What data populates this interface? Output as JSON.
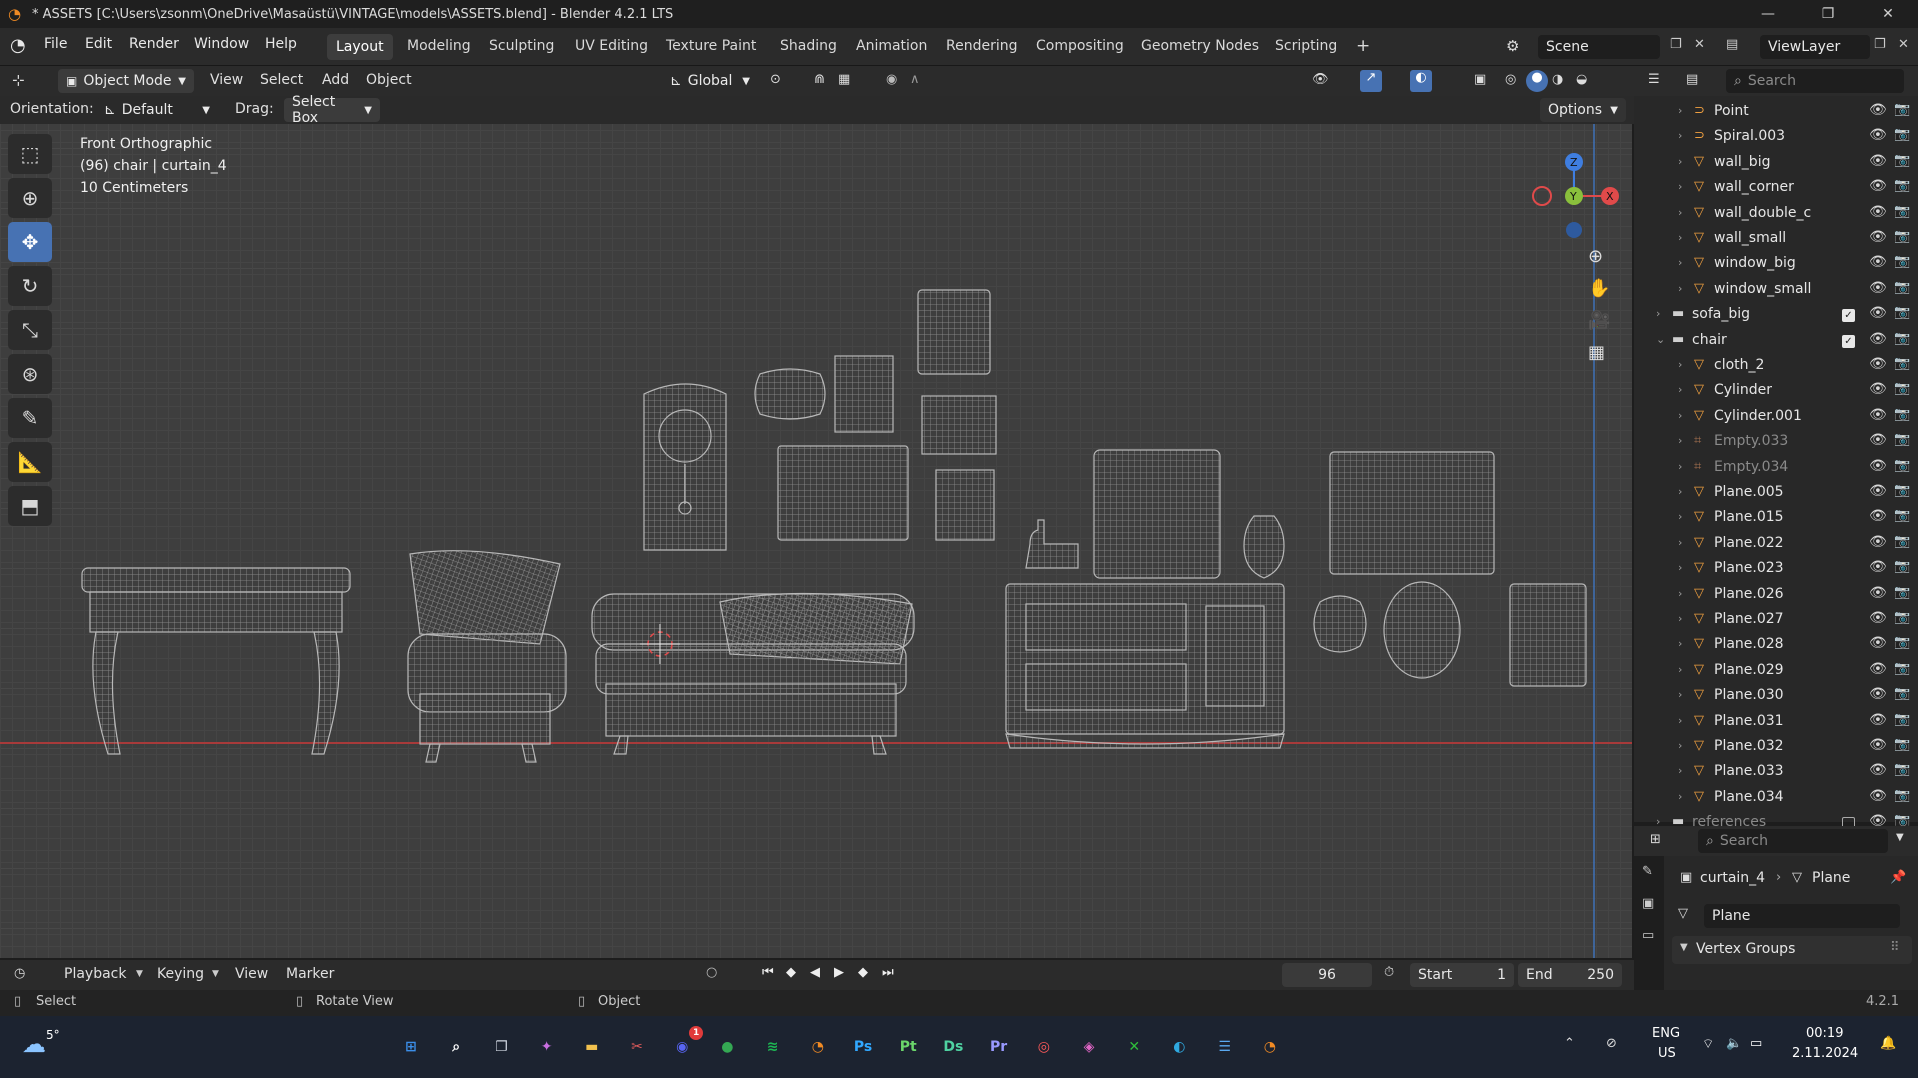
{
  "window": {
    "title": "* ASSETS [C:\\Users\\zsonm\\OneDrive\\Masaüstü\\VINTAGE\\models\\ASSETS.blend] - Blender 4.2.1 LTS",
    "controls": [
      "—",
      "❐",
      "✕"
    ]
  },
  "menu": [
    "File",
    "Edit",
    "Render",
    "Window",
    "Help"
  ],
  "workspaces": [
    "Layout",
    "Modeling",
    "Sculpting",
    "UV Editing",
    "Texture Paint",
    "Shading",
    "Animation",
    "Rendering",
    "Compositing",
    "Geometry Nodes",
    "Scripting"
  ],
  "add_tab": "+",
  "scene": {
    "label": "Scene",
    "view_layer": "ViewLayer"
  },
  "header": {
    "mode": "Object Mode",
    "view": "View",
    "select": "Select",
    "add": "Add",
    "object": "Object",
    "transform": "Global"
  },
  "header2": {
    "orientation_label": "Orientation:",
    "orientation_value": "Default",
    "drag_label": "Drag:",
    "drag_value": "Select Box",
    "options": "Options"
  },
  "viewport": {
    "view_name": "Front Orthographic",
    "object_info": "(96) chair | curtain_4",
    "scale": "10 Centimeters"
  },
  "gizmo": {
    "z": "Z",
    "y": "Y",
    "x": "X"
  },
  "outliner": {
    "search_placeholder": "Search",
    "rows": [
      {
        "name": "Point",
        "indent": 2,
        "icon": "curve",
        "dim": false
      },
      {
        "name": "Spiral.003",
        "indent": 2,
        "icon": "curve",
        "dim": false
      },
      {
        "name": "wall_big",
        "indent": 2,
        "icon": "mesh",
        "dim": false
      },
      {
        "name": "wall_corner",
        "indent": 2,
        "icon": "mesh",
        "dim": false
      },
      {
        "name": "wall_double_c",
        "indent": 2,
        "icon": "mesh",
        "dim": false
      },
      {
        "name": "wall_small",
        "indent": 2,
        "icon": "mesh",
        "dim": false
      },
      {
        "name": "window_big",
        "indent": 2,
        "icon": "mesh",
        "dim": false
      },
      {
        "name": "window_small",
        "indent": 2,
        "icon": "mesh",
        "dim": false
      },
      {
        "name": "sofa_big",
        "indent": 1,
        "icon": "collection",
        "dim": false,
        "checkbox": true
      },
      {
        "name": "chair",
        "indent": 1,
        "icon": "collection",
        "dim": false,
        "checkbox": true,
        "expanded": true
      },
      {
        "name": "cloth_2",
        "indent": 2,
        "icon": "mesh",
        "dim": false
      },
      {
        "name": "Cylinder",
        "indent": 2,
        "icon": "mesh",
        "dim": false
      },
      {
        "name": "Cylinder.001",
        "indent": 2,
        "icon": "mesh",
        "dim": false
      },
      {
        "name": "Empty.033",
        "indent": 2,
        "icon": "empty",
        "dim": true
      },
      {
        "name": "Empty.034",
        "indent": 2,
        "icon": "empty",
        "dim": true
      },
      {
        "name": "Plane.005",
        "indent": 2,
        "icon": "mesh",
        "dim": false
      },
      {
        "name": "Plane.015",
        "indent": 2,
        "icon": "mesh",
        "dim": false
      },
      {
        "name": "Plane.022",
        "indent": 2,
        "icon": "mesh",
        "dim": false
      },
      {
        "name": "Plane.023",
        "indent": 2,
        "icon": "mesh",
        "dim": false
      },
      {
        "name": "Plane.026",
        "indent": 2,
        "icon": "mesh",
        "dim": false
      },
      {
        "name": "Plane.027",
        "indent": 2,
        "icon": "mesh",
        "dim": false
      },
      {
        "name": "Plane.028",
        "indent": 2,
        "icon": "mesh",
        "dim": false
      },
      {
        "name": "Plane.029",
        "indent": 2,
        "icon": "mesh",
        "dim": false
      },
      {
        "name": "Plane.030",
        "indent": 2,
        "icon": "mesh",
        "dim": false
      },
      {
        "name": "Plane.031",
        "indent": 2,
        "icon": "mesh",
        "dim": false
      },
      {
        "name": "Plane.032",
        "indent": 2,
        "icon": "mesh",
        "dim": false
      },
      {
        "name": "Plane.033",
        "indent": 2,
        "icon": "mesh",
        "dim": false
      },
      {
        "name": "Plane.034",
        "indent": 2,
        "icon": "mesh",
        "dim": false
      },
      {
        "name": "references",
        "indent": 1,
        "icon": "collection",
        "dim": true,
        "checkbox": false
      }
    ]
  },
  "properties": {
    "search_placeholder": "Search",
    "breadcrumb_object": "curtain_4",
    "breadcrumb_data": "Plane",
    "mesh_name": "Plane",
    "panel": "Vertex Groups"
  },
  "timeline": {
    "playback": "Playback",
    "keying": "Keying",
    "view": "View",
    "marker": "Marker",
    "frame": "96",
    "start_label": "Start",
    "start": "1",
    "end_label": "End",
    "end": "250"
  },
  "status": {
    "select": "Select",
    "rotate": "Rotate View",
    "object": "Object",
    "version": "4.2.1"
  },
  "taskbar": {
    "weather": "5°",
    "lang1": "ENG",
    "lang2": "US",
    "time": "00:19",
    "date": "2.11.2024",
    "discord_badge": "1",
    "apps": [
      {
        "name": "start",
        "glyph": "⊞",
        "color": "#3b8ee8"
      },
      {
        "name": "search",
        "glyph": "⌕",
        "color": "#ffffff"
      },
      {
        "name": "task-view",
        "glyph": "❐",
        "color": "#cfd6e0"
      },
      {
        "name": "copilot",
        "glyph": "✦",
        "color": "#c86ee0"
      },
      {
        "name": "file-explorer",
        "glyph": "▬",
        "color": "#f2c14e"
      },
      {
        "name": "snipping",
        "glyph": "✂",
        "color": "#e05b5b"
      },
      {
        "name": "discord",
        "glyph": "◉",
        "color": "#5865f2"
      },
      {
        "name": "chrome",
        "glyph": "●",
        "color": "#34a853"
      },
      {
        "name": "spotify",
        "glyph": "≋",
        "color": "#1db954"
      },
      {
        "name": "blender-a",
        "glyph": "◔",
        "color": "#f08a24"
      },
      {
        "name": "photoshop",
        "glyph": "Ps",
        "color": "#31a8ff"
      },
      {
        "name": "painter",
        "glyph": "Pt",
        "color": "#6bd56b"
      },
      {
        "name": "designer",
        "glyph": "Ds",
        "color": "#4fd1a1"
      },
      {
        "name": "premiere",
        "glyph": "Pr",
        "color": "#9999ff"
      },
      {
        "name": "creative-cloud",
        "glyph": "◎",
        "color": "#ff5a5a"
      },
      {
        "name": "davinci",
        "glyph": "◈",
        "color": "#e066c6"
      },
      {
        "name": "xbox",
        "glyph": "✕",
        "color": "#2fbd3b"
      },
      {
        "name": "edge",
        "glyph": "◐",
        "color": "#2fa9e0"
      },
      {
        "name": "notepad",
        "glyph": "☰",
        "color": "#5aa9f0"
      },
      {
        "name": "blender-b",
        "glyph": "◔",
        "color": "#f08a24"
      }
    ]
  }
}
